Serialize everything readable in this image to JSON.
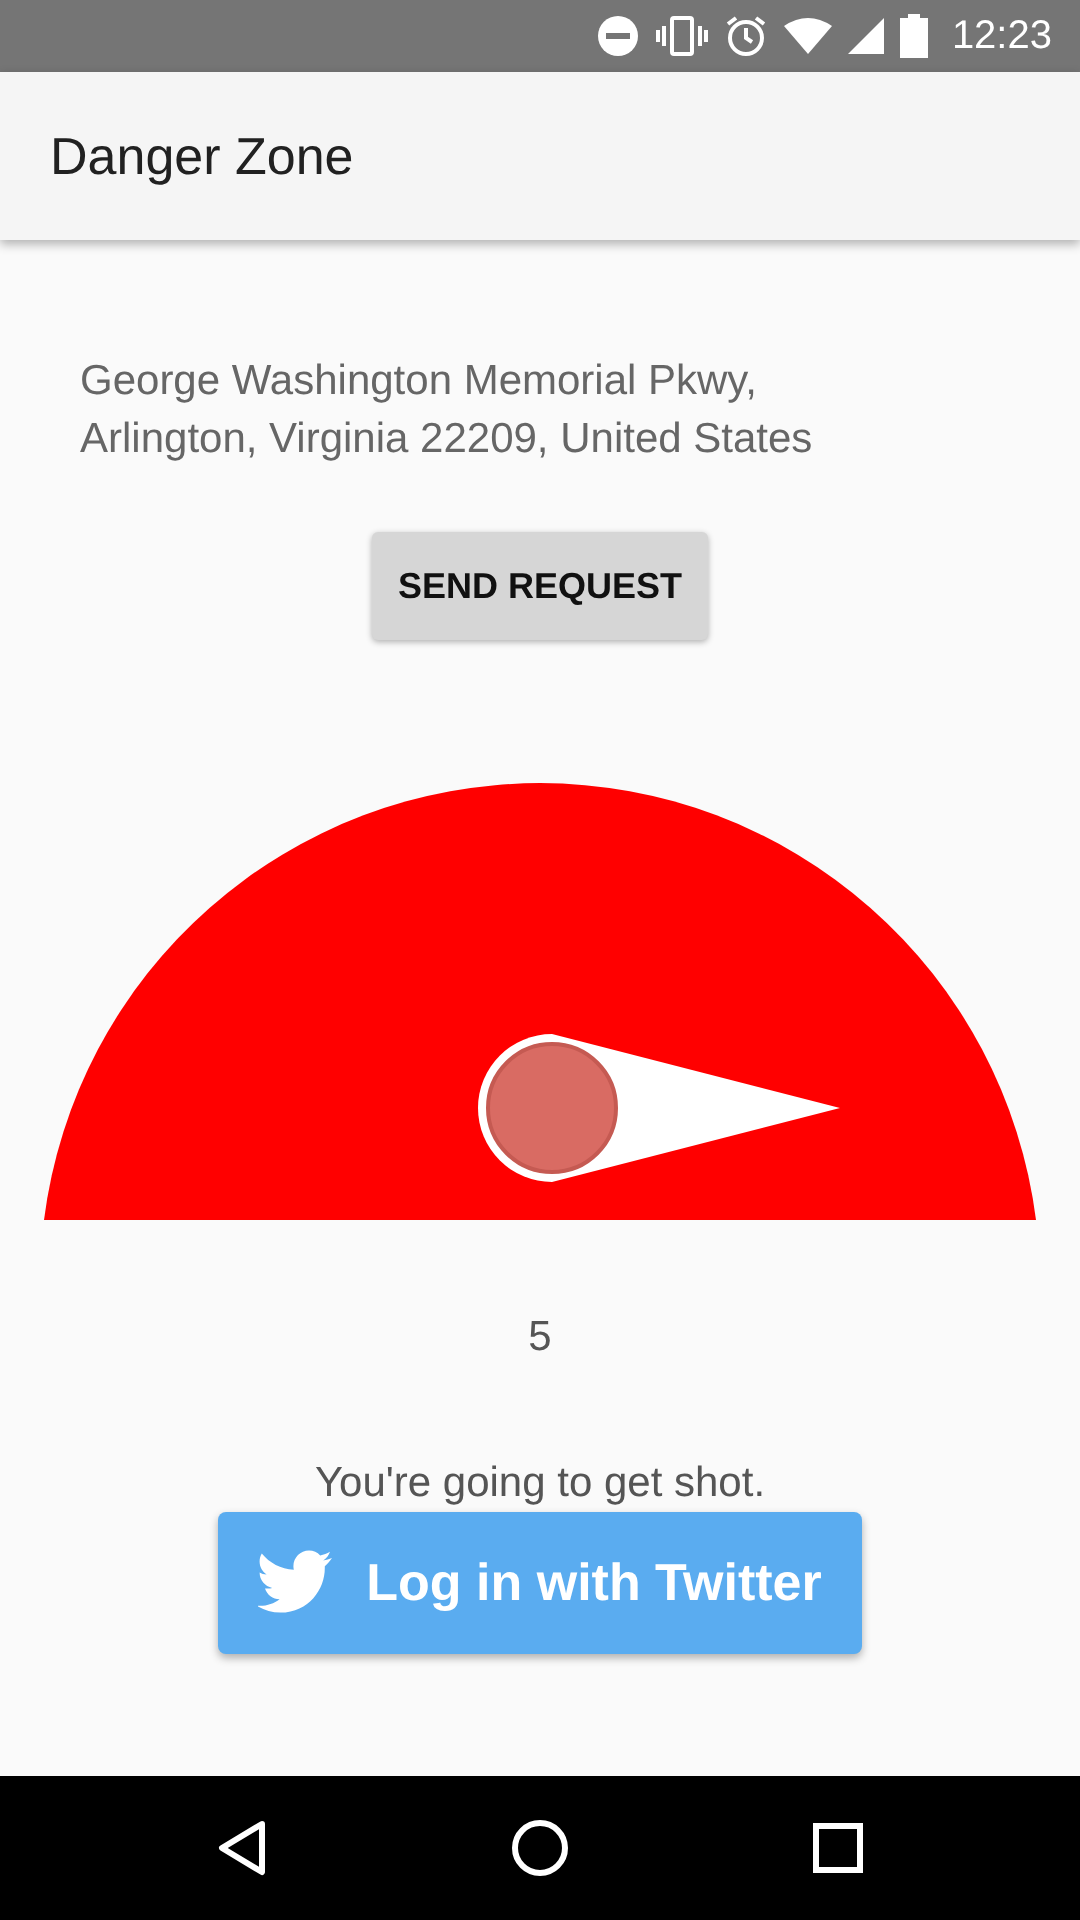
{
  "status_bar": {
    "time": "12:23"
  },
  "app_bar": {
    "title": "Danger Zone"
  },
  "address": "George Washington Memorial Pkwy, Arlington, Virginia 22209, United States",
  "send_button": "SEND REQUEST",
  "value": "5",
  "message": "You're going to get shot.",
  "twitter_button": "Log in with Twitter"
}
